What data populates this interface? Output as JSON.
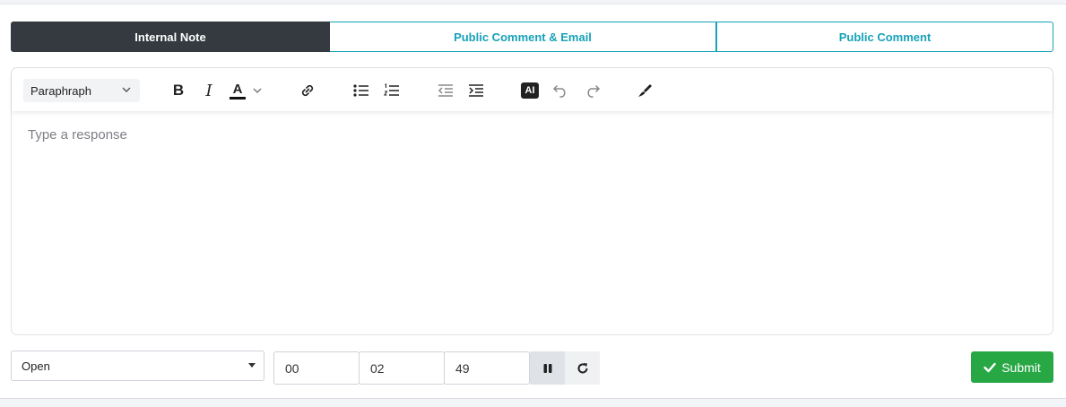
{
  "tabs": [
    {
      "label": "Internal Note",
      "active": true
    },
    {
      "label": "Public Comment & Email",
      "active": false
    },
    {
      "label": "Public Comment",
      "active": false
    }
  ],
  "toolbar": {
    "block_format": "Paraphraph",
    "bold": "B",
    "italic": "I",
    "text_color_label": "A",
    "ai_label": "AI",
    "icons": [
      "chevron-down-icon",
      "bold-icon",
      "italic-icon",
      "text-color-icon",
      "link-icon",
      "bullet-list-icon",
      "numbered-list-icon",
      "outdent-icon",
      "indent-icon",
      "ai-icon",
      "undo-icon",
      "redo-icon",
      "clear-format-icon"
    ]
  },
  "editor": {
    "placeholder": "Type a response"
  },
  "bottom": {
    "status": "Open",
    "timer": {
      "hours": "00",
      "minutes": "02",
      "seconds": "49"
    },
    "submit_label": "Submit"
  },
  "colors": {
    "accent": "#17a2b8",
    "active_tab": "#343a40",
    "submit": "#28a745"
  }
}
